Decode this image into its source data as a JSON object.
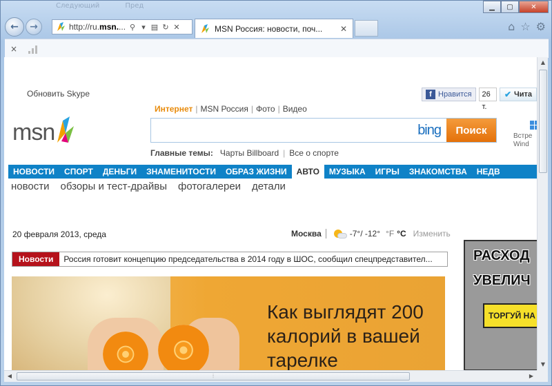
{
  "browser": {
    "ghost_titles": [
      "Следующий",
      "Пред"
    ],
    "address": {
      "prefix": "http://ru.",
      "domain": "msn.",
      "tail": "..."
    },
    "tab_title": "MSN Россия: новости, поч...",
    "stop_icon": "×"
  },
  "page": {
    "skype_link": "Обновить Skype",
    "facebook": {
      "like_label": "Нравится",
      "like_count": "26 т."
    },
    "twitter": {
      "label": "Чита"
    },
    "logo_text": "msn",
    "search_tabs": [
      "Интернет",
      "MSN Россия",
      "Фото",
      "Видео"
    ],
    "search": {
      "value": "",
      "placeholder": "",
      "engine_label": "bing",
      "button_label": "Поиск"
    },
    "promo": {
      "line1": "Встре",
      "line2": "Wind"
    },
    "topics": {
      "label": "Главные темы:",
      "items": [
        "Чарты Billboard",
        "Все о спорте"
      ]
    },
    "categories": [
      "НОВОСТИ",
      "СПОРТ",
      "ДЕНЬГИ",
      "ЗНАМЕНИТОСТИ",
      "ОБРАЗ ЖИЗНИ",
      "АВТО",
      "МУЗЫКА",
      "ИГРЫ",
      "ЗНАКОМСТВА",
      "НЕДВ"
    ],
    "active_category": "АВТО",
    "subnav": [
      "новости",
      "обзоры и тест-драйвы",
      "фотогалереи",
      "детали"
    ],
    "date": "20 февраля 2013, среда",
    "weather": {
      "city": "Москва",
      "temps": "-7°/ -12°",
      "unit_f": "°F",
      "unit_c": "°C",
      "change_label": "Изменить"
    },
    "ticker": {
      "label": "Новости",
      "text": "Россия готовит концепцию председательства в 2014 году в ШОС, сообщил спецпредставител..."
    },
    "hero": {
      "headline": "Как выглядят 200 калорий в вашей тарелке"
    },
    "ad": {
      "line1": "РАСХОД",
      "line2": "УВЕЛИЧ",
      "cta": "ТОРГУЙ НА"
    }
  },
  "colors": {
    "category_bar": "#0f82c7",
    "search_button": "#e88b0c",
    "ticker_label": "#b5121b"
  }
}
